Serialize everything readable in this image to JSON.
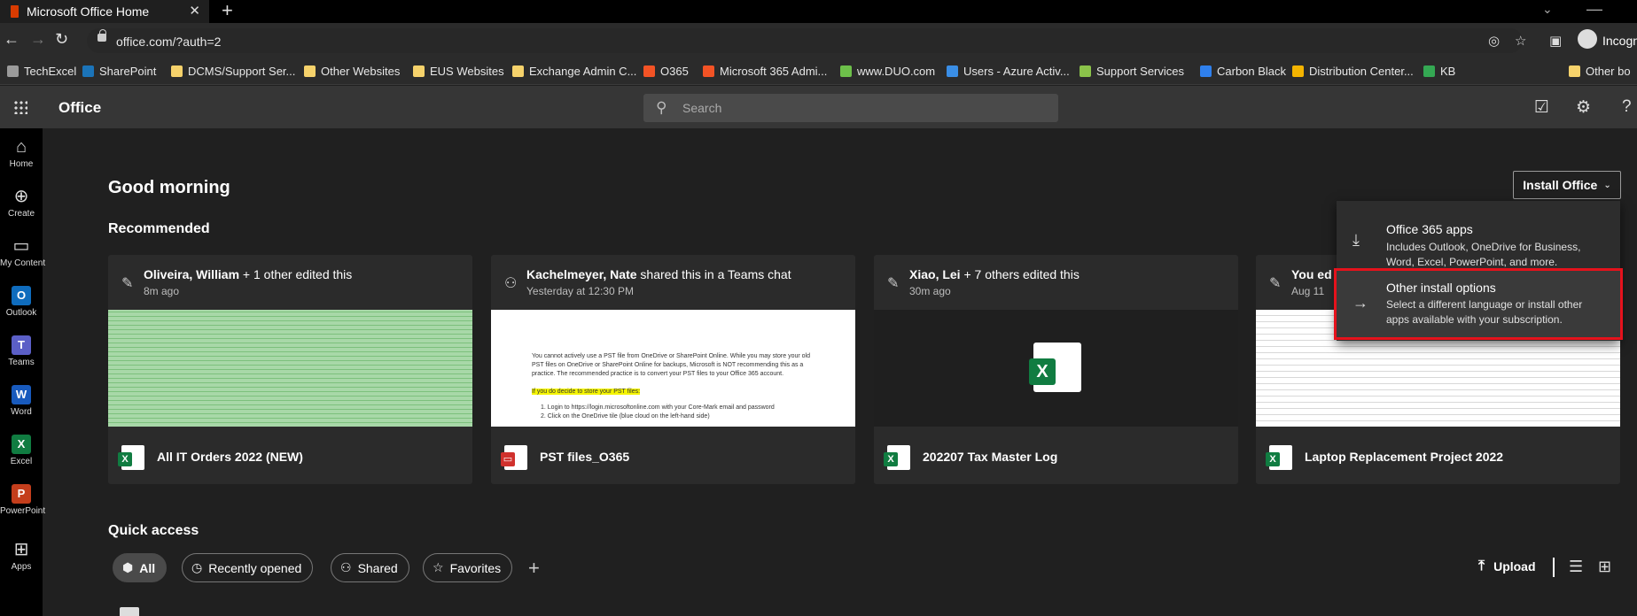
{
  "browser": {
    "tab_title": "Microsoft Office Home",
    "close_glyph": "✕",
    "new_tab_glyph": "+",
    "url": "office.com/?auth=2",
    "incognito_label": "Incognito",
    "bookmarks": [
      {
        "label": "TechExcel",
        "color": "#9b9b9b"
      },
      {
        "label": "SharePoint",
        "color": "#1b74b9"
      },
      {
        "label": "DCMS/Support Ser...",
        "color": "#f6d26b"
      },
      {
        "label": "Other Websites",
        "color": "#f6d26b"
      },
      {
        "label": "EUS Websites",
        "color": "#f6d26b"
      },
      {
        "label": "Exchange Admin C...",
        "color": "#f6d26b"
      },
      {
        "label": "O365",
        "color": "#f35325"
      },
      {
        "label": "Microsoft 365 Admi...",
        "color": "#f35325"
      },
      {
        "label": "www.DUO.com",
        "color": "#6dc04a"
      },
      {
        "label": "Users - Azure Activ...",
        "color": "#3a8ee6"
      },
      {
        "label": "Support Services",
        "color": "#8bc34a"
      },
      {
        "label": "Carbon Black",
        "color": "#2f80ed"
      },
      {
        "label": "Distribution Center...",
        "color": "#f4b400"
      },
      {
        "label": "KB",
        "color": "#34a853"
      },
      {
        "label": "Other bo",
        "color": "#f6d26b"
      }
    ]
  },
  "header": {
    "brand": "Office",
    "search_placeholder": "Search"
  },
  "rail": [
    {
      "label": "Home",
      "icon": "home-icon"
    },
    {
      "label": "Create",
      "icon": "plus-circle-icon"
    },
    {
      "label": "My Content",
      "icon": "folder-icon"
    },
    {
      "label": "Outlook",
      "icon": "outlook-icon",
      "tile_letter": "O",
      "color": "#0f6cbd"
    },
    {
      "label": "Teams",
      "icon": "teams-icon",
      "tile_letter": "T",
      "color": "#5b5fc7"
    },
    {
      "label": "Word",
      "icon": "word-icon",
      "tile_letter": "W",
      "color": "#185abd"
    },
    {
      "label": "Excel",
      "icon": "excel-icon",
      "tile_letter": "X",
      "color": "#107c41"
    },
    {
      "label": "PowerPoint",
      "icon": "powerpoint-icon",
      "tile_letter": "P",
      "color": "#c43e1c"
    },
    {
      "label": "Apps",
      "icon": "apps-icon"
    }
  ],
  "main": {
    "greeting": "Good morning",
    "recommended_title": "Recommended",
    "cards": [
      {
        "who_bold": "Oliveira, William",
        "who_rest": " + 1 other edited this",
        "time": "8m ago",
        "name": "All IT Orders 2022 (NEW)",
        "file_type": "excel"
      },
      {
        "who_bold": "Kachelmeyer, Nate",
        "who_rest": " shared this in a Teams chat",
        "time": "Yesterday at 12:30 PM",
        "name": "PST files_O365",
        "file_type": "pdf"
      },
      {
        "who_bold": "Xiao, Lei",
        "who_rest": " + 7 others edited this",
        "time": "30m ago",
        "name": "202207 Tax Master Log",
        "file_type": "excel"
      },
      {
        "who_bold": "You ed",
        "who_rest": "",
        "time": "Aug 11",
        "name": "Laptop Replacement Project 2022",
        "file_type": "excel"
      }
    ],
    "doc_preview": {
      "para1": "You cannot actively use a PST file from OneDrive or SharePoint Online. While you may store your old PST files on OneDrive or SharePoint Online for backups, Microsoft is NOT recommending this as a practice. The recommended practice is to convert your PST files to your Office 365 account.",
      "highlight": "If you do decide to store your PST files:",
      "step1": "1.   Login to https://login.microsoftonline.com with your Core-Mark email and password",
      "step2": "2.   Click on the OneDrive tile (blue cloud on the left-hand side)"
    }
  },
  "install": {
    "button_label": "Install Office",
    "menu": [
      {
        "title": "Office 365 apps",
        "desc": "Includes Outlook, OneDrive for Business, Word, Excel, PowerPoint, and more.",
        "icon": "download-icon"
      },
      {
        "title": "Other install options",
        "desc": "Select a different language or install other apps available with your subscription.",
        "icon": "arrow-right-icon"
      }
    ]
  },
  "quick_access": {
    "title": "Quick access",
    "filters": [
      "All",
      "Recently opened",
      "Shared",
      "Favorites"
    ],
    "selected_filter": "All",
    "upload_label": "Upload"
  },
  "colors": {
    "accent_red": "#e5121c",
    "excel_green": "#107c41",
    "pdf_red": "#d0312d"
  }
}
